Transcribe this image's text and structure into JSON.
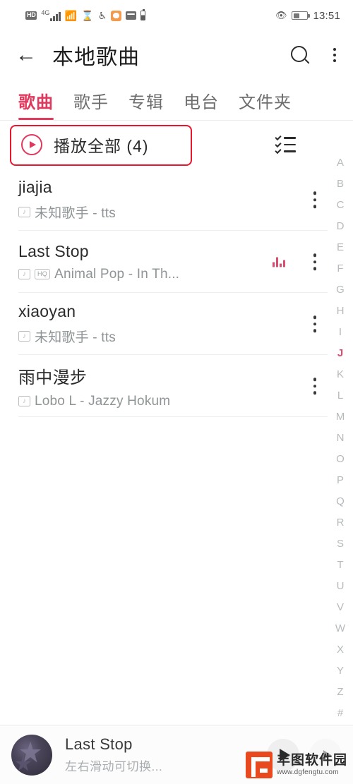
{
  "status_bar": {
    "hd_label": "HD",
    "network_label": "4G",
    "icons": [
      "hd-badge",
      "signal-bars-icon",
      "wifi-icon",
      "hourglass-icon",
      "accessibility-icon",
      "orange-app-icon",
      "mail-app-icon",
      "small-battery-icon",
      "eye-comfort-icon",
      "battery-icon"
    ],
    "time": "13:51"
  },
  "app_bar": {
    "title": "本地歌曲",
    "back_icon": "back-arrow-icon",
    "search_icon": "search-icon",
    "more_icon": "more-vertical-icon"
  },
  "tabs": [
    {
      "label": "歌曲",
      "active": true
    },
    {
      "label": "歌手",
      "active": false
    },
    {
      "label": "专辑",
      "active": false
    },
    {
      "label": "电台",
      "active": false
    },
    {
      "label": "文件夹",
      "active": false
    }
  ],
  "play_all": {
    "label": "播放全部 (4)",
    "count": 4,
    "play_icon": "play-circle-icon",
    "multiselect_icon": "multi-select-list-icon",
    "highlight_color": "#e8162c"
  },
  "songs": [
    {
      "title": "jiajia",
      "artist": "未知歌手 - tts",
      "local_badge": "local-file-icon",
      "hq_badge": null,
      "playing": false,
      "menu_icon": "more-vertical-icon"
    },
    {
      "title": "Last Stop",
      "artist": "Animal Pop - In Th...",
      "local_badge": "local-file-icon",
      "hq_badge": "HQ",
      "playing": true,
      "menu_icon": "more-vertical-icon"
    },
    {
      "title": "xiaoyan",
      "artist": "未知歌手 - tts",
      "local_badge": "local-file-icon",
      "hq_badge": null,
      "playing": false,
      "menu_icon": "more-vertical-icon"
    },
    {
      "title": "雨中漫步",
      "artist": "Lobo L - Jazzy Hokum",
      "local_badge": "local-file-icon",
      "hq_badge": null,
      "playing": false,
      "menu_icon": "more-vertical-icon"
    }
  ],
  "alpha_index": {
    "letters": [
      "A",
      "B",
      "C",
      "D",
      "E",
      "F",
      "G",
      "H",
      "I",
      "J",
      "K",
      "L",
      "M",
      "N",
      "O",
      "P",
      "Q",
      "R",
      "S",
      "T",
      "U",
      "V",
      "W",
      "X",
      "Y",
      "Z",
      "#"
    ],
    "active": "J"
  },
  "player": {
    "album_art": "album-art-thumbnail",
    "title": "Last Stop",
    "hint": "左右滑动可切换...",
    "play_icon": "play-icon",
    "next_icon": "play-icon-ghost"
  },
  "watermark": {
    "name": "丰图软件园",
    "url": "www.dgfengtu.com",
    "logo_color": "#e8491f"
  },
  "colors": {
    "accent": "#e0395e",
    "equalizer": "#d94c70",
    "annotation": "#e8162c",
    "text_primary": "#2b2b2b",
    "text_secondary": "#8f9496"
  }
}
